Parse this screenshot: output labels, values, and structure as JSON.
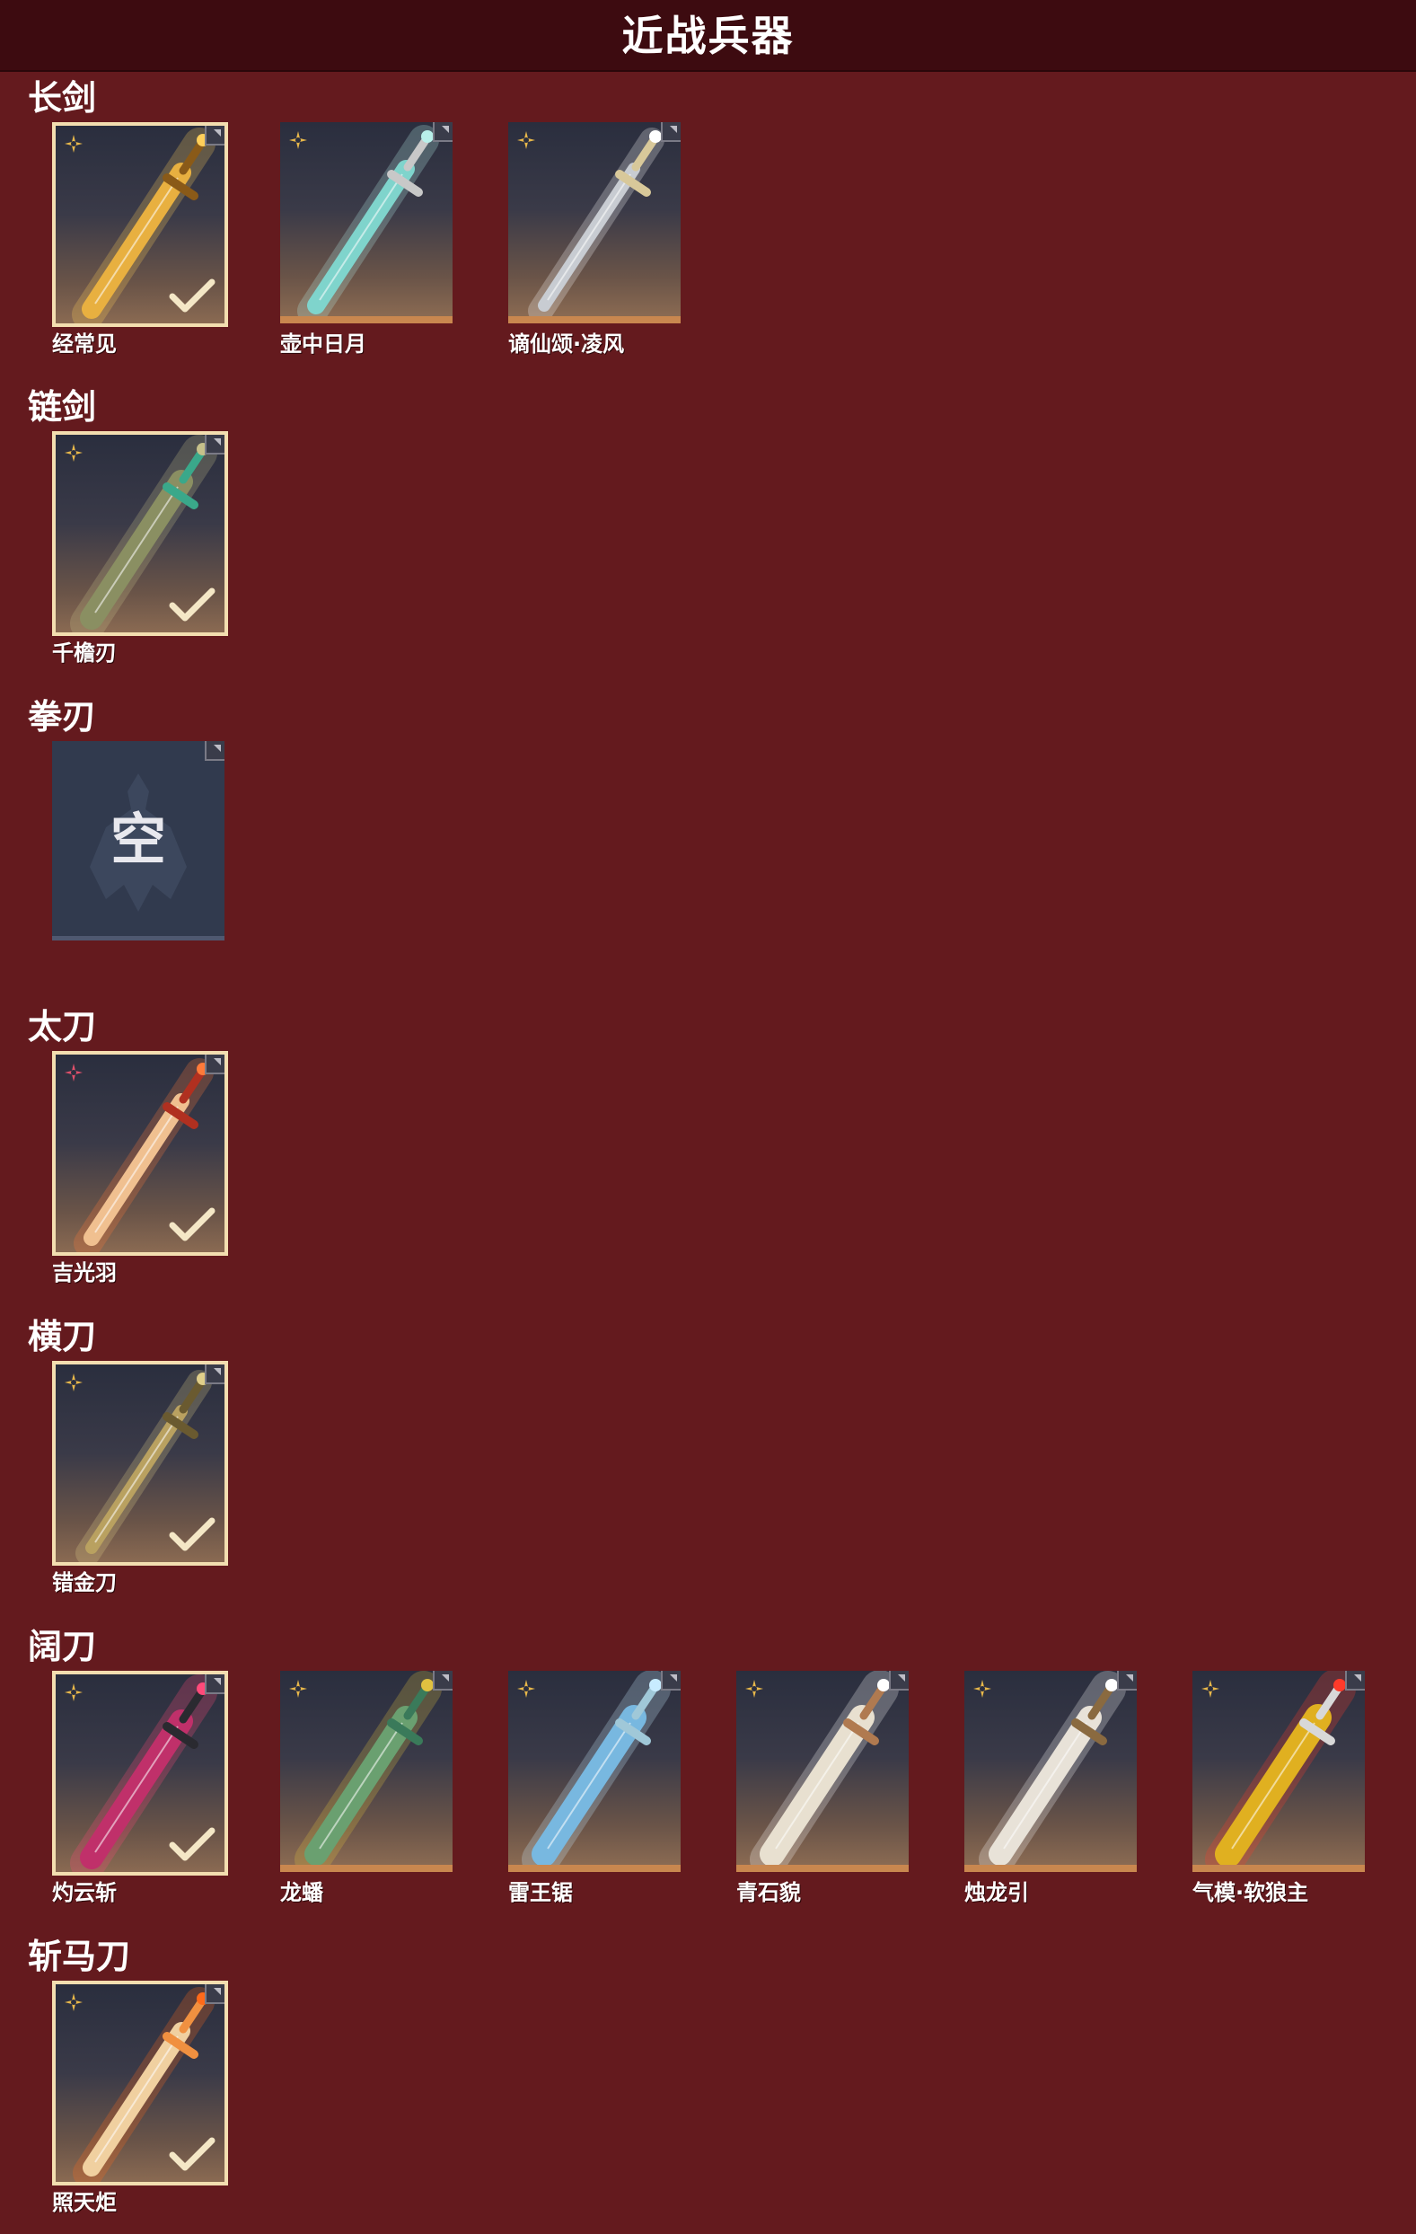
{
  "header": {
    "title": "近战兵器"
  },
  "colors": {
    "background": "#641a1e",
    "header": "#3d0b10",
    "selected_border": "#f3deb0",
    "unselected_bar": "#c9874f"
  },
  "sections": [
    {
      "title": "长剑",
      "items": [
        {
          "name": "经常见",
          "rarity": "gold-star-icon",
          "selected": true,
          "weapon": "golden-flame-sword"
        },
        {
          "name": "壶中日月",
          "rarity": "gold-star-icon",
          "selected": false,
          "weapon": "jade-sword"
        },
        {
          "name": "谪仙颂·凌风",
          "rarity": "gold-star-icon",
          "selected": false,
          "weapon": "silver-sword"
        }
      ]
    },
    {
      "title": "链剑",
      "items": [
        {
          "name": "千檐刃",
          "rarity": "gold-star-icon",
          "selected": true,
          "weapon": "chain-sword"
        }
      ]
    },
    {
      "title": "拳刃",
      "items": [
        {
          "name": "",
          "empty_label": "空",
          "empty": true,
          "weapon": "empty-slot"
        }
      ]
    },
    {
      "title": "太刀",
      "items": [
        {
          "name": "吉光羽",
          "rarity": "red-star-icon",
          "selected": true,
          "weapon": "flame-katana"
        }
      ]
    },
    {
      "title": "横刀",
      "items": [
        {
          "name": "错金刀",
          "rarity": "gold-star-icon",
          "selected": true,
          "weapon": "gilded-blades"
        }
      ]
    },
    {
      "title": "阔刀",
      "items": [
        {
          "name": "灼云斩",
          "rarity": "gold-star-icon",
          "selected": true,
          "weapon": "crimson-broadblade"
        },
        {
          "name": "龙蟠",
          "rarity": "gold-star-icon",
          "selected": false,
          "weapon": "jade-dragon-blade"
        },
        {
          "name": "雷王锯",
          "rarity": "gold-star-icon",
          "selected": false,
          "weapon": "ice-saw-blade"
        },
        {
          "name": "青石貌",
          "rarity": "gold-star-icon",
          "selected": false,
          "weapon": "white-beast-blade"
        },
        {
          "name": "烛龙引",
          "rarity": "gold-star-icon",
          "selected": false,
          "weapon": "white-dragon-blade"
        },
        {
          "name": "气模·软狼主",
          "rarity": "gold-star-icon",
          "selected": false,
          "weapon": "red-gold-wolf-blade"
        }
      ]
    },
    {
      "title": "斩马刀",
      "items": [
        {
          "name": "照天炬",
          "rarity": "gold-star-icon",
          "selected": true,
          "weapon": "fire-glaive"
        }
      ]
    }
  ]
}
